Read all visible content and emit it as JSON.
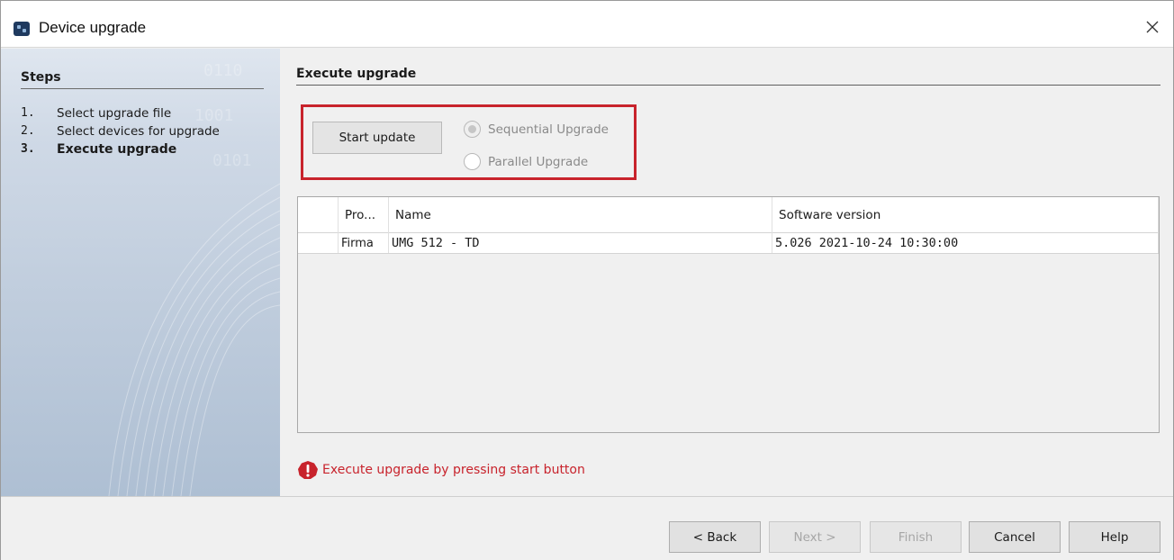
{
  "window": {
    "title": "Device upgrade"
  },
  "sidebar": {
    "heading": "Steps",
    "steps": [
      {
        "num": "1.",
        "label": "Select upgrade file"
      },
      {
        "num": "2.",
        "label": "Select devices for upgrade"
      },
      {
        "num": "3.",
        "label": "Execute upgrade"
      }
    ]
  },
  "main": {
    "title": "Execute upgrade",
    "start_button": "Start update",
    "radio_sequential": "Sequential Upgrade",
    "radio_parallel": "Parallel Upgrade",
    "table": {
      "columns": [
        "",
        "Pro...",
        "Name",
        "Software version"
      ],
      "rows": [
        {
          "progress": "",
          "type": "Firma",
          "name": "UMG 512 - TD",
          "software_version": "5.026 2021-10-24 10:30:00"
        }
      ]
    },
    "error_message": "Execute upgrade by pressing start button"
  },
  "footer": {
    "back": "< Back",
    "next": "Next >",
    "finish": "Finish",
    "cancel": "Cancel",
    "help": "Help"
  },
  "colors": {
    "accent_red": "#c8232c",
    "window_bg": "#f0f0f0"
  }
}
